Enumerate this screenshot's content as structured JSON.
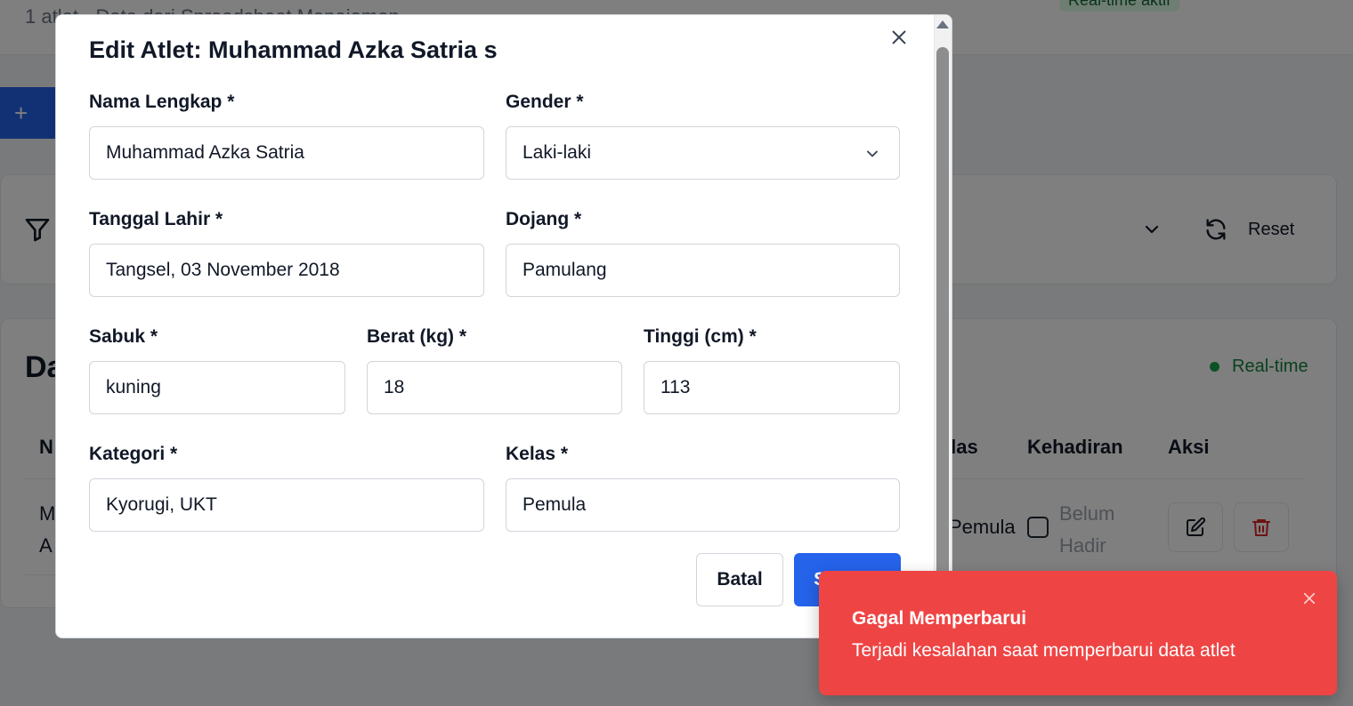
{
  "background": {
    "subtitle": "1 atlet · Data dari Spreadsheet Manajemen",
    "realtime_badge_top": "Real-time aktif",
    "add_icon": "+",
    "reset_label": "Reset",
    "list_title": "Da",
    "realtime_label": "Real-time",
    "table_headers": {
      "name_initial": "N",
      "kelas": "Kelas",
      "kehadiran": "Kehadiran",
      "aksi": "Aksi"
    },
    "row": {
      "name_line1": "M",
      "name_line2": "A",
      "kelas": "Pemula",
      "hadir_line1": "Belum",
      "hadir_line2": "Hadir"
    },
    "icons": [
      "filter-icon",
      "chevron-down-icon",
      "refresh-icon",
      "edit-icon",
      "trash-icon"
    ],
    "colors": {
      "primary": "#2563eb",
      "success": "#16a34a",
      "danger": "#dc2626"
    }
  },
  "modal": {
    "title": "Edit Atlet: Muhammad Azka Satria s",
    "fields": {
      "nama": {
        "label": "Nama Lengkap *",
        "value": "Muhammad Azka Satria"
      },
      "gender": {
        "label": "Gender *",
        "value": "Laki-laki"
      },
      "tanggal_lahir": {
        "label": "Tanggal Lahir *",
        "value": "Tangsel, 03 November 2018"
      },
      "dojang": {
        "label": "Dojang *",
        "value": "Pamulang"
      },
      "sabuk": {
        "label": "Sabuk *",
        "value": "kuning"
      },
      "berat": {
        "label": "Berat (kg) *",
        "value": "18"
      },
      "tinggi": {
        "label": "Tinggi (cm) *",
        "value": "113"
      },
      "kategori": {
        "label": "Kategori *",
        "value": "Kyorugi, UKT"
      },
      "kelas": {
        "label": "Kelas *",
        "value": "Pemula"
      }
    },
    "cancel_label": "Batal",
    "save_label": "Simpan",
    "icons": [
      "close-icon",
      "chevron-down-icon"
    ]
  },
  "toast": {
    "title": "Gagal Memperbarui",
    "message": "Terjadi kesalahan saat memperbarui data atlet",
    "color": "#ef4444",
    "icon": "close-icon"
  }
}
